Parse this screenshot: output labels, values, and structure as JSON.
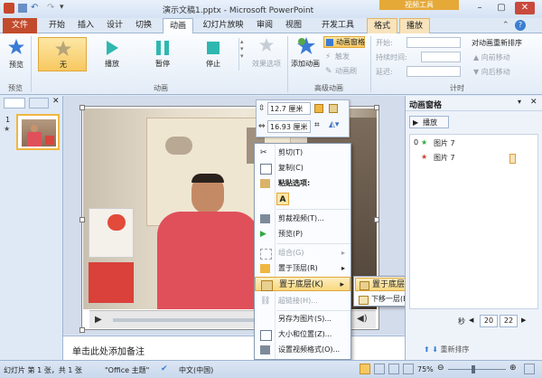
{
  "window": {
    "title": "演示文稿1.pptx - Microsoft PowerPoint",
    "contextual_tab": "视频工具"
  },
  "tabs": [
    "文件",
    "开始",
    "插入",
    "设计",
    "切换",
    "动画",
    "幻灯片放映",
    "审阅",
    "视图",
    "开发工具",
    "格式",
    "播放"
  ],
  "ribbon": {
    "preview_label": "预览",
    "preview_group": "预览",
    "effects": [
      "无",
      "播放",
      "暂停",
      "停止"
    ],
    "effect_options": "效果选项",
    "animation_group": "动画",
    "add_animation": "添加动画",
    "animation_pane_btn": "动画窗格",
    "trigger": "触发",
    "anim_painter": "动画刷",
    "advanced_group": "高级动画",
    "start_label": "开始:",
    "duration_label": "持续时间:",
    "delay_label": "延迟:",
    "timing_group": "计时",
    "reorder_title": "对动画重新排序",
    "move_earlier": "向前移动",
    "move_later": "向后移动"
  },
  "thumbnail": {
    "number": "1",
    "star": "★"
  },
  "mini_toolbar": {
    "height_value": "12.7 厘米",
    "width_value": "16.93 厘米"
  },
  "context_menu": {
    "items": [
      {
        "label": "剪切(T)",
        "disabled": false
      },
      {
        "label": "复制(C)",
        "disabled": false
      },
      {
        "label": "粘贴选项:",
        "disabled": false
      },
      {
        "label": "A",
        "disabled": false
      },
      {
        "label": "剪裁视频(T)...",
        "disabled": false
      },
      {
        "label": "预览(P)",
        "disabled": false
      },
      {
        "label": "组合(G)",
        "disabled": true
      },
      {
        "label": "置于顶层(R)",
        "disabled": false
      },
      {
        "label": "置于底层(K)",
        "disabled": false
      },
      {
        "label": "超链接(H)...",
        "disabled": true
      },
      {
        "label": "另存为图片(S)...",
        "disabled": false
      },
      {
        "label": "大小和位置(Z)...",
        "disabled": false
      },
      {
        "label": "设置视频格式(O)...",
        "disabled": false
      }
    ]
  },
  "submenu": {
    "items": [
      {
        "label": "置于底层(K)"
      },
      {
        "label": "下移一层(B)"
      }
    ]
  },
  "notes_placeholder": "单击此处添加备注",
  "anim_pane": {
    "title": "动画窗格",
    "play_label": "播放",
    "entries": [
      {
        "index": "0",
        "label": "图片 7"
      },
      {
        "index": "",
        "label": "图片 7"
      }
    ],
    "seconds_label": "秒",
    "timeline_values": [
      "20",
      "22"
    ],
    "reorder_label": "重新排序"
  },
  "status": {
    "slide_info": "幻灯片 第 1 张，共 1 张",
    "theme": "\"Office 主题\"",
    "language": "中文(中国)",
    "zoom": "75%"
  },
  "colors": {
    "accent_orange": "#f7c860",
    "file_tab": "#c24b2b",
    "pink_arrow": "#e040c8",
    "shirt_red": "#e0505a"
  }
}
